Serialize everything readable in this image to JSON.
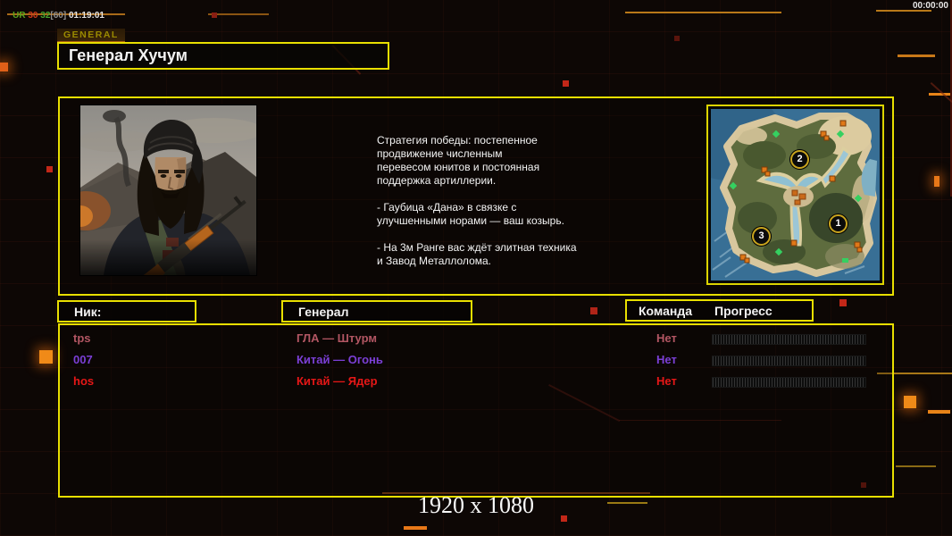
{
  "overlay": {
    "perf_segments": [
      {
        "text": "UR ",
        "color": "#5aa31e"
      },
      {
        "text": "30 ",
        "color": "#cf3a1a"
      },
      {
        "text": "32",
        "color": "#46a52e"
      },
      {
        "text": "[60] ",
        "color": "#8f8f8f"
      },
      {
        "text": "01:19:01",
        "color": "#e6e6e6"
      }
    ],
    "clock": "00:00:00"
  },
  "tab": {
    "label": "GENERAL"
  },
  "header": {
    "title": "Генерал Хучум"
  },
  "briefing": {
    "paragraphs": [
      "Стратегия победы: постепенное\nпродвижение численным\nперевесом юнитов и постоянная\nподдержка артиллерии.",
      "- Гаубица «Дана» в связке с\nулучшенными норами — ваш козырь.",
      "- На 3м Ранге вас ждёт элитная техника\nи Завод Металлолома."
    ]
  },
  "map": {
    "start_positions": [
      {
        "num": "1"
      },
      {
        "num": "2"
      },
      {
        "num": "3"
      }
    ]
  },
  "columns": {
    "nick": "Ник:",
    "general": "Генерал",
    "team": "Команда",
    "progress": "Прогресс"
  },
  "players": [
    {
      "name": "tps",
      "general": "ГЛА — Штурм",
      "team": "Нет",
      "color": "#b25663",
      "progress": 0
    },
    {
      "name": "007",
      "general": "Китай — Огонь",
      "team": "Нет",
      "color": "#7b3fd6",
      "progress": 0
    },
    {
      "name": "hos",
      "general": "Китай — Ядер",
      "team": "Нет",
      "color": "#e61717",
      "progress": 0
    }
  ],
  "footer": {
    "resolution": "1920 x 1080"
  },
  "colors": {
    "frame_yellow": "#e8df00",
    "accent_orange": "#e07818",
    "alert_red": "#c22718"
  }
}
